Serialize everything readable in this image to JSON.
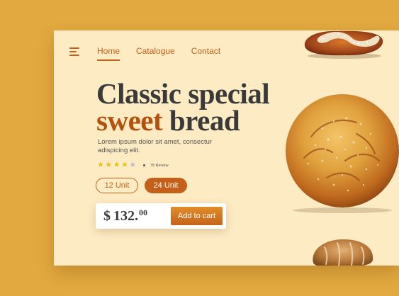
{
  "nav": {
    "items": [
      "Home",
      "Catalogue",
      "Contact"
    ]
  },
  "hero": {
    "title_line1": "Classic special",
    "title_accent": "sweet",
    "title_rest": " bread",
    "description": "Lorem ipsum dolor sit amet, consectur adispicing elit."
  },
  "rating": {
    "stars": 4,
    "max": 5,
    "reviews_label": "78 Review"
  },
  "units": [
    "12 Unit",
    "24 Unit"
  ],
  "selected_unit": "24 Unit",
  "price": {
    "currency": "$",
    "main": "132.",
    "cents": "00"
  },
  "cart_label": "Add to cart",
  "colors": {
    "background": "#e1a93f",
    "card": "#fdebc4",
    "accent": "#c4601a",
    "dark_text": "#3a3a3a",
    "star_on": "#ecbe1c",
    "star_off": "#b9bcc7"
  }
}
